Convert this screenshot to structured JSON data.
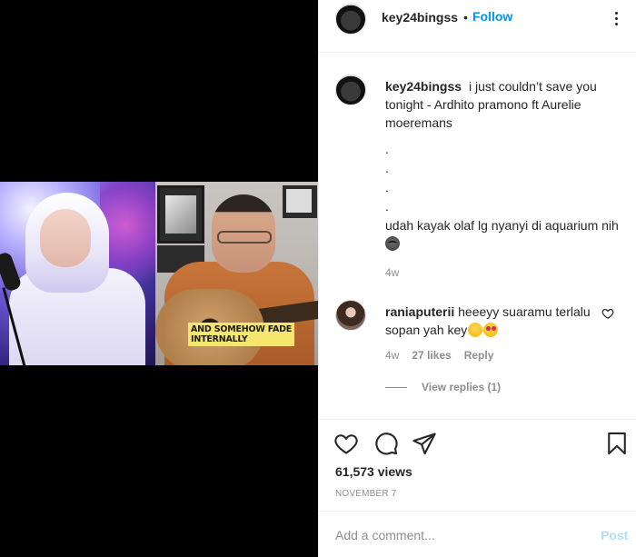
{
  "post": {
    "username": "key24bingss",
    "dot": "•",
    "follow_label": "Follow",
    "video_caption_lines": [
      "AND SOMEHOW FADE",
      "INTERNALLY"
    ]
  },
  "caption": {
    "username": "key24bingss",
    "text": "i just couldn’t save you tonight - Ardhito pramono ft Aurelie moeremans",
    "dots": [
      ".",
      ".",
      ".",
      "."
    ],
    "extra_text": "udah kayak olaf lg nyanyi di aquarium nih",
    "time": "4w"
  },
  "comment": {
    "username": "raniaputerii",
    "text": "heeeyy suaramu terlalu sopan yah key",
    "time": "4w",
    "likes": "27 likes",
    "reply_label": "Reply",
    "view_replies": "View replies (1)"
  },
  "stats": {
    "views": "61,573 views",
    "date": "NOVEMBER 7"
  },
  "add_comment": {
    "placeholder": "Add a comment...",
    "post_label": "Post"
  },
  "icons": [
    "more-icon",
    "heart-icon",
    "comment-icon",
    "share-icon",
    "bookmark-icon",
    "heart-small-icon"
  ],
  "colors": {
    "link": "#0095f6",
    "muted": "#8e8e8e",
    "post_disabled": "#b2dffc",
    "text": "#262626"
  }
}
